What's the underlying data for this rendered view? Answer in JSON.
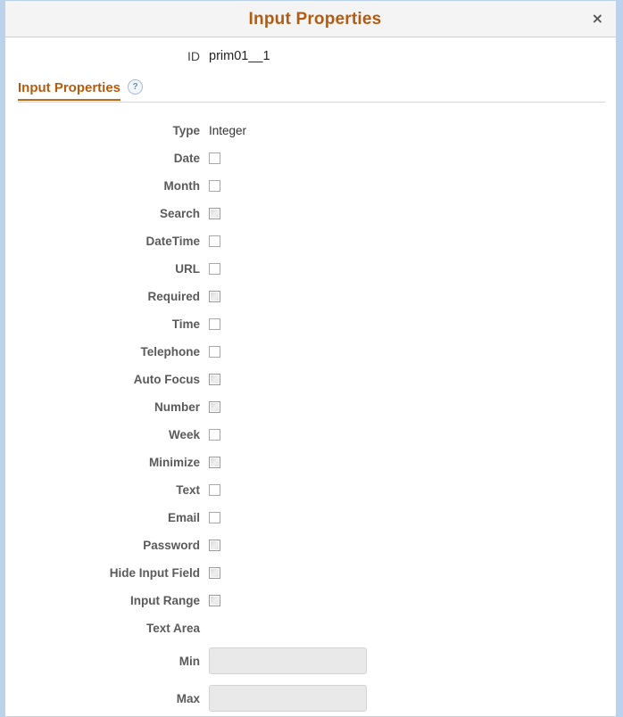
{
  "dialog": {
    "title": "Input Properties",
    "close_label": "×",
    "close_icon": "close-icon",
    "accent_color": "#b35c10",
    "border_color": "#bcd2ea",
    "titlebar_bg": "#f4f4f4"
  },
  "id_field": {
    "label": "ID",
    "value": "prim01__1"
  },
  "section": {
    "title": "Input Properties",
    "help_icon": "help-icon",
    "help_glyph": "?"
  },
  "type_field": {
    "label": "Type",
    "value": "Integer"
  },
  "checkbox_fields": [
    {
      "label": "Date",
      "state": "plain"
    },
    {
      "label": "Month",
      "state": "plain"
    },
    {
      "label": "Search",
      "state": "shaded"
    },
    {
      "label": "DateTime",
      "state": "plain"
    },
    {
      "label": "URL",
      "state": "plain"
    },
    {
      "label": "Required",
      "state": "shaded"
    },
    {
      "label": "Time",
      "state": "plain"
    },
    {
      "label": "Telephone",
      "state": "plain"
    },
    {
      "label": "Auto Focus",
      "state": "shaded"
    },
    {
      "label": "Number",
      "state": "shaded"
    },
    {
      "label": "Week",
      "state": "plain"
    },
    {
      "label": "Minimize",
      "state": "shaded"
    },
    {
      "label": "Text",
      "state": "plain"
    },
    {
      "label": "Email",
      "state": "plain"
    },
    {
      "label": "Password",
      "state": "shaded"
    },
    {
      "label": "Hide Input Field",
      "state": "shaded"
    },
    {
      "label": "Input Range",
      "state": "shaded"
    }
  ],
  "text_area_field": {
    "label": "Text Area"
  },
  "min_field": {
    "label": "Min",
    "value": "",
    "placeholder": ""
  },
  "max_field": {
    "label": "Max",
    "value": "",
    "placeholder": ""
  }
}
